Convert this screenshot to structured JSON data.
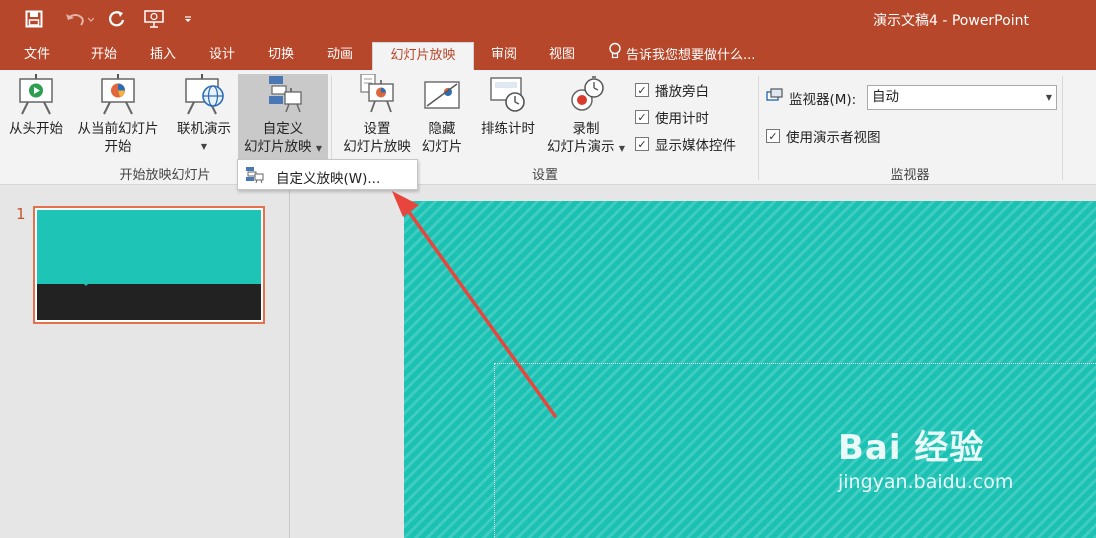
{
  "window": {
    "title": "演示文稿4 - PowerPoint"
  },
  "qat": {
    "save_icon": "save-icon",
    "undo_icon": "undo-icon",
    "redo_icon": "repeat-icon",
    "present_icon": "present-from-beginning-icon",
    "customize_icon": "customize-qat-icon"
  },
  "tabs": [
    {
      "label": "文件"
    },
    {
      "label": "开始"
    },
    {
      "label": "插入"
    },
    {
      "label": "设计"
    },
    {
      "label": "切换"
    },
    {
      "label": "动画"
    },
    {
      "label": "幻灯片放映",
      "active": true
    },
    {
      "label": "审阅"
    },
    {
      "label": "视图"
    }
  ],
  "tell_me": "告诉我您想要做什么...",
  "ribbon": {
    "start_group": {
      "label": "开始放映幻灯片",
      "from_beginning": "从头开始",
      "from_current_line1": "从当前幻灯片",
      "from_current_line2": "开始",
      "online_present": "联机演示",
      "custom_show_line1": "自定义",
      "custom_show_line2": "幻灯片放映"
    },
    "setup_group": {
      "label": "设置",
      "setup_show_line1": "设置",
      "setup_show_line2": "幻灯片放映",
      "hide_slide_line1": "隐藏",
      "hide_slide_line2": "幻灯片",
      "rehearse": "排练计时",
      "record_line1": "录制",
      "record_line2": "幻灯片演示",
      "play_narrations": "播放旁白",
      "use_timings": "使用计时",
      "show_media_controls": "显示媒体控件"
    },
    "monitors_group": {
      "label": "监视器",
      "monitor_label": "监视器(M):",
      "monitor_value": "自动",
      "use_presenter_view": "使用演示者视图"
    }
  },
  "dropdown_menu": {
    "item": "自定义放映(W)..."
  },
  "slides": {
    "thumbnail_number": "1"
  },
  "watermark": {
    "logo": "Bai 经验",
    "url": "jingyan.baidu.com"
  },
  "colors": {
    "titlebar": "#b7472a",
    "slide_teal": "#1bc2b4",
    "arrow_red": "#e8463c",
    "thumb_border": "#e5704c"
  }
}
